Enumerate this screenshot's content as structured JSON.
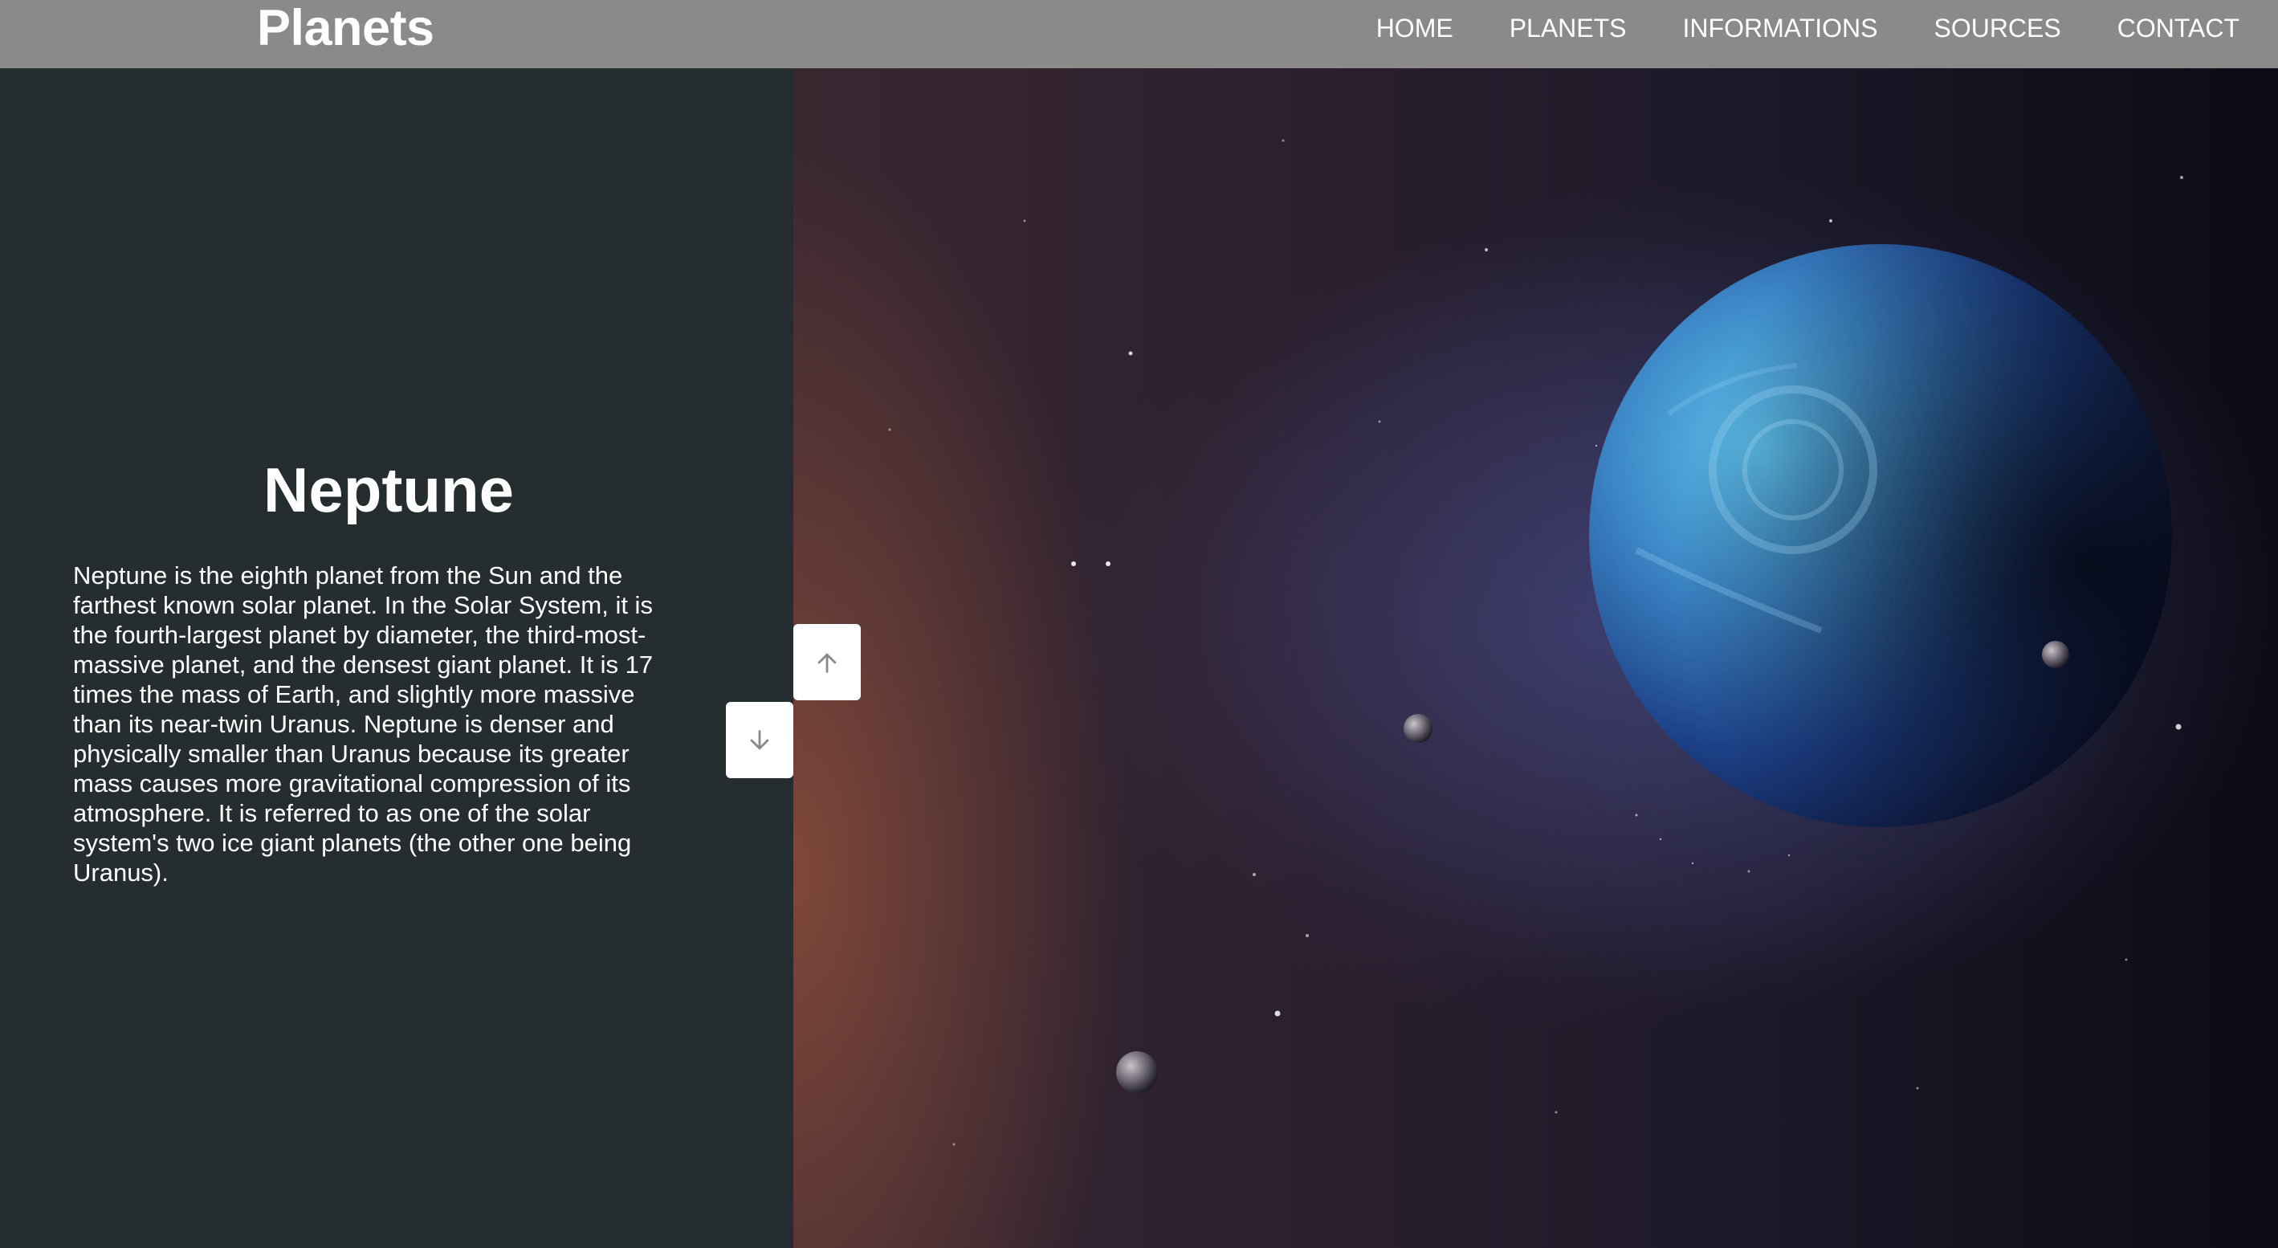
{
  "header": {
    "logo": "Planets",
    "nav": [
      "HOME",
      "PLANETS",
      "INFORMATIONS",
      "SOURCES",
      "CONTACT"
    ]
  },
  "planet": {
    "name": "Neptune",
    "description": "Neptune is the eighth planet from the Sun and the farthest known solar planet. In the Solar System, it is the fourth-largest planet by diameter, the third-most-massive planet, and the densest giant planet. It is 17 times the mass of Earth, and slightly more massive than its near-twin Uranus. Neptune is denser and physically smaller than Uranus because its greater mass causes more gravitational compression of its atmosphere. It is referred to as one of the solar system's two ice giant planets (the other one being Uranus)."
  },
  "controls": {
    "up_icon": "arrow-up-icon",
    "down_icon": "arrow-down-icon"
  },
  "colors": {
    "header_bg": "#8a8a88",
    "panel_bg": "#252d31",
    "planet_blue": "#4fa6dc"
  }
}
